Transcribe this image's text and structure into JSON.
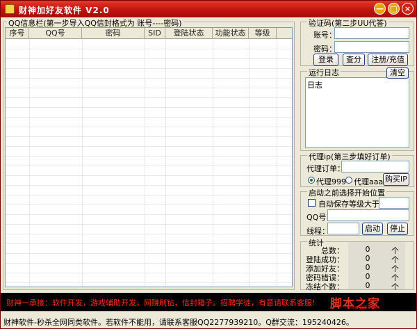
{
  "window": {
    "title": "财神加好友软件 V2.0",
    "min_symbol": "—",
    "max_symbol": "□",
    "close_symbol": "×"
  },
  "qq_panel": {
    "label": "QQ信息栏(第一步导入QQ信封格式为  账号----密码)",
    "columns": [
      "序号",
      "QQ号",
      "密码",
      "SID",
      "登陆状态",
      "功能状态",
      "等级"
    ]
  },
  "captcha": {
    "label": "验证码(第二步UU代答)",
    "account_label": "账号：",
    "password_label": "密码：",
    "login_button": "登录",
    "query_button": "查分",
    "register_button": "注册/充值"
  },
  "log": {
    "label": "运行日志",
    "clear_button": "清空",
    "content": "日志"
  },
  "proxy": {
    "label": "代理ip(第三步填好订单)",
    "order_label": "代理订单：",
    "option1": "代理999",
    "option2": "代理aaa",
    "buy_button": "购买IP"
  },
  "start_pos": {
    "label": "启动之前选择开始位置",
    "autosave_label": "自动保存等级大于",
    "qq_label": "QQ号：",
    "thread_label": "线程：",
    "start_button": "启动",
    "stop_button": "停止"
  },
  "stats": {
    "label": "统计",
    "unit": "个",
    "items": [
      {
        "label": "总数：",
        "value": "0"
      },
      {
        "label": "登陆成功：",
        "value": "0"
      },
      {
        "label": "添加好友：",
        "value": "0"
      },
      {
        "label": "密码错误：",
        "value": "0"
      },
      {
        "label": "冻结个数：",
        "value": "0"
      }
    ]
  },
  "marquee": "财神一承接：软件开发，游戏辅助开发，网赚刷钻，信封箱子。招聘学徒，有意请联系客服!",
  "watermark": {
    "main": "脚本之家",
    "sub": "www.jb51.net"
  },
  "status": "财神软件-秒杀全网同类软件。若软件不能用，请联系客服QQ2277939210。Q群交流：195240426。",
  "colors": {
    "title_bar": "#c0140e",
    "marquee_bg": "#000000",
    "marquee_text": "#ff2a10"
  }
}
